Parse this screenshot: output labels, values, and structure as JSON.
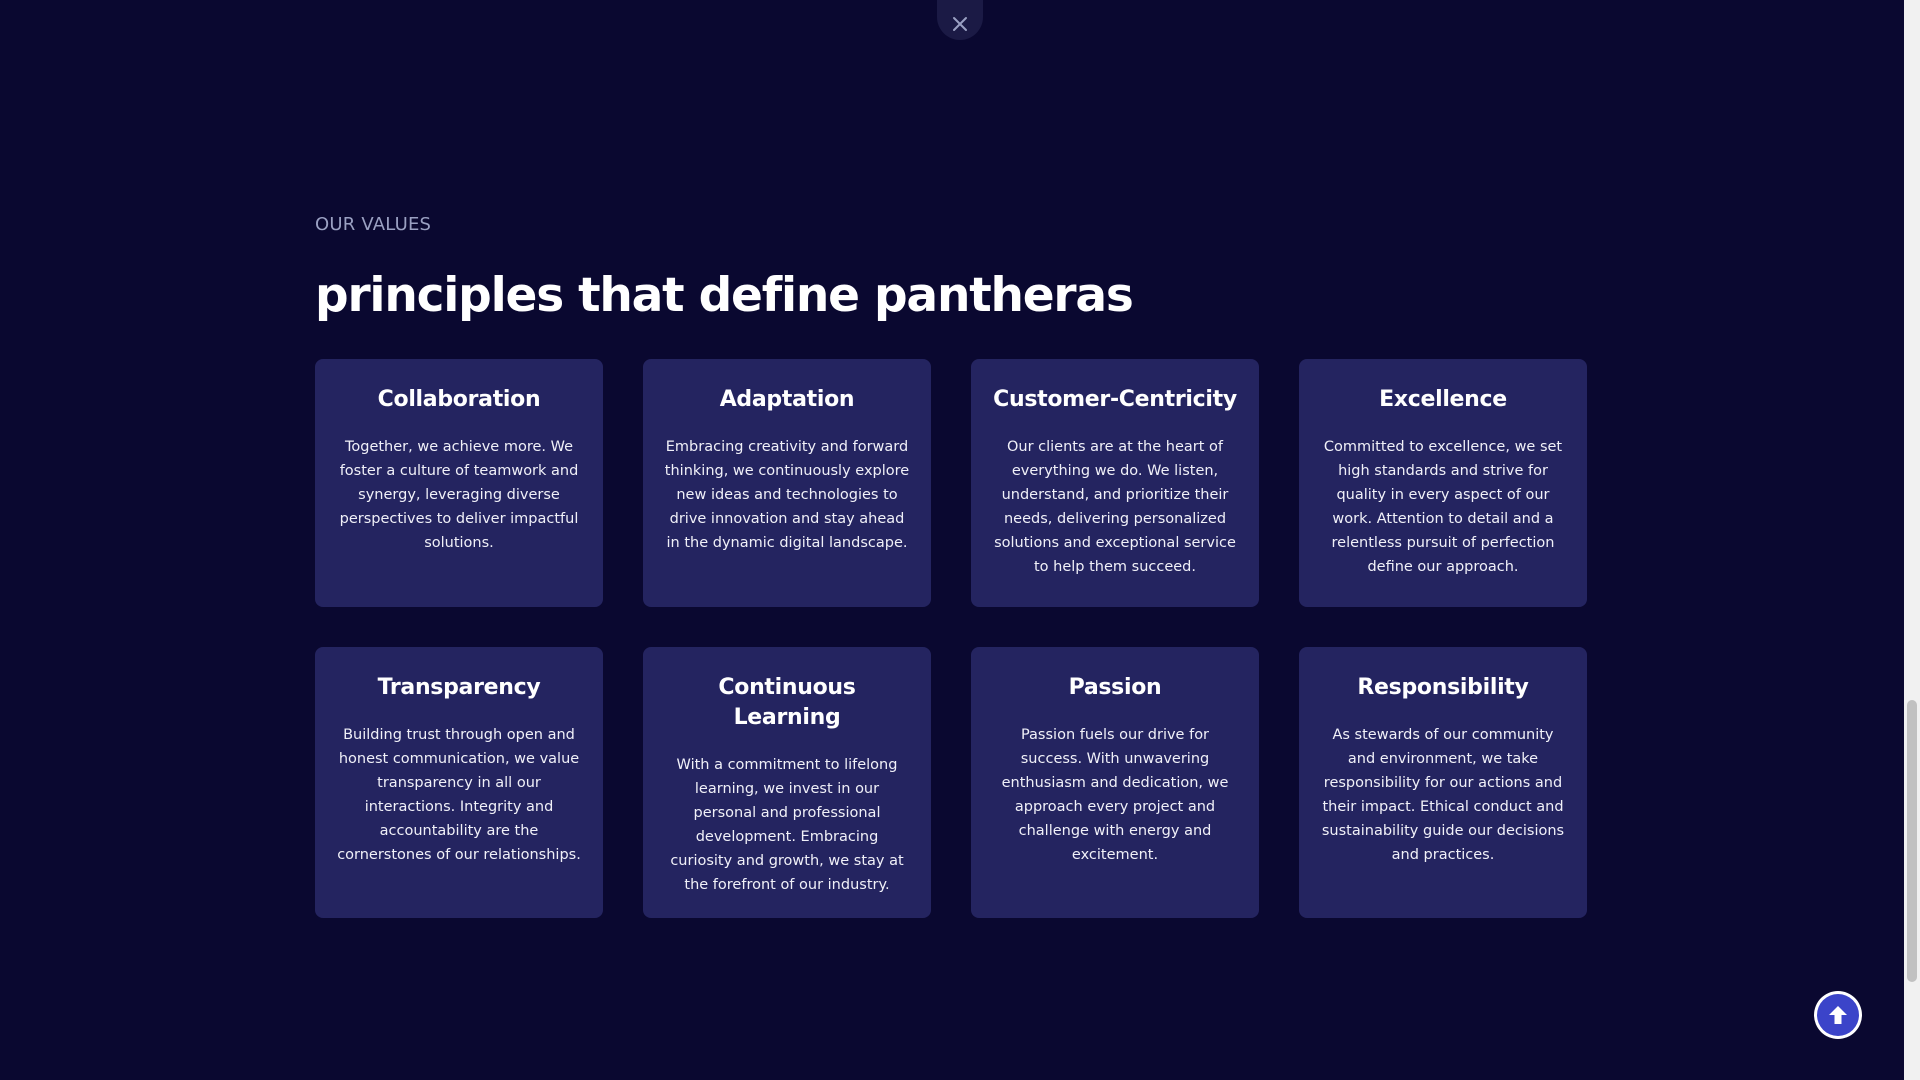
{
  "close_button": {
    "icon": "close-icon"
  },
  "values_section": {
    "eyebrow": "OUR VALUES",
    "heading": "principles that define pantheras",
    "cards": [
      {
        "title": "Collaboration",
        "text": "Together, we achieve more. We foster a culture of teamwork and synergy, leveraging diverse perspectives to deliver impactful solutions."
      },
      {
        "title": "Adaptation",
        "text": "Embracing creativity and forward thinking, we continuously explore new ideas and technologies to drive innovation and stay ahead in the dynamic digital landscape."
      },
      {
        "title": "Customer-Centricity",
        "text": "Our clients are at the heart of everything we do. We listen, understand, and prioritize their needs, delivering personalized solutions and exceptional service to help them succeed."
      },
      {
        "title": "Excellence",
        "text": "Committed to excellence, we set high standards and strive for quality in every aspect of our work. Attention to detail and a relentless pursuit of perfection define our approach."
      },
      {
        "title": "Transparency",
        "text": "Building trust through open and honest communication, we value transparency in all our interactions. Integrity and accountability are the cornerstones of our relationships."
      },
      {
        "title": "Continuous Learning",
        "text": "With a commitment to lifelong learning, we invest in our personal and professional development. Embracing curiosity and growth, we stay at the forefront of our industry."
      },
      {
        "title": "Passion",
        "text": "Passion fuels our drive for success. With unwavering enthusiasm and dedication, we approach every project and challenge with energy and excitement."
      },
      {
        "title": "Responsibility",
        "text": "As stewards of our community and environment, we take responsibility for our actions and their impact. Ethical conduct and sustainability guide our decisions and practices."
      }
    ]
  },
  "scroll_top_button": {
    "icon": "arrow-up-circle-icon"
  },
  "colors": {
    "background": "#0a0830",
    "card": "#242460",
    "eyebrow": "#9aa0c2",
    "accent": "#3b44c9"
  }
}
